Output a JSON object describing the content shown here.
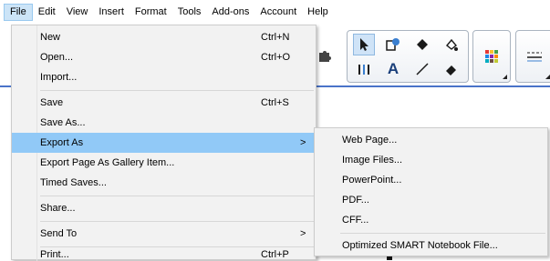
{
  "menubar": {
    "items": [
      "File",
      "Edit",
      "View",
      "Insert",
      "Format",
      "Tools",
      "Add-ons",
      "Account",
      "Help"
    ],
    "active": "File"
  },
  "file_menu": {
    "new": {
      "label": "New",
      "shortcut": "Ctrl+N"
    },
    "open": {
      "label": "Open...",
      "shortcut": "Ctrl+O"
    },
    "import": {
      "label": "Import..."
    },
    "save": {
      "label": "Save",
      "shortcut": "Ctrl+S"
    },
    "save_as": {
      "label": "Save As..."
    },
    "export_as": {
      "label": "Export As",
      "arrow": ">"
    },
    "export_gallery": {
      "label": "Export Page As Gallery Item..."
    },
    "timed_saves": {
      "label": "Timed Saves..."
    },
    "share": {
      "label": "Share..."
    },
    "send_to": {
      "label": "Send To",
      "arrow": ">"
    },
    "print": {
      "label": "Print...",
      "shortcut": "Ctrl+P"
    }
  },
  "export_submenu": {
    "items": [
      "Web Page...",
      "Image Files...",
      "PowerPoint...",
      "PDF...",
      "CFF..."
    ],
    "optimized": "Optimized SMART Notebook File..."
  },
  "colors": {
    "highlight": "#91c9f7",
    "menu_bg": "#f2f2f2",
    "accent_line": "#4a73c9"
  },
  "icons": [
    "puzzle-icon",
    "select-arrow-icon",
    "shapes-icon",
    "fill-icon",
    "pen-icon",
    "text-icon",
    "line-icon",
    "eraser-icon",
    "palette-icon",
    "line-style-icon"
  ]
}
